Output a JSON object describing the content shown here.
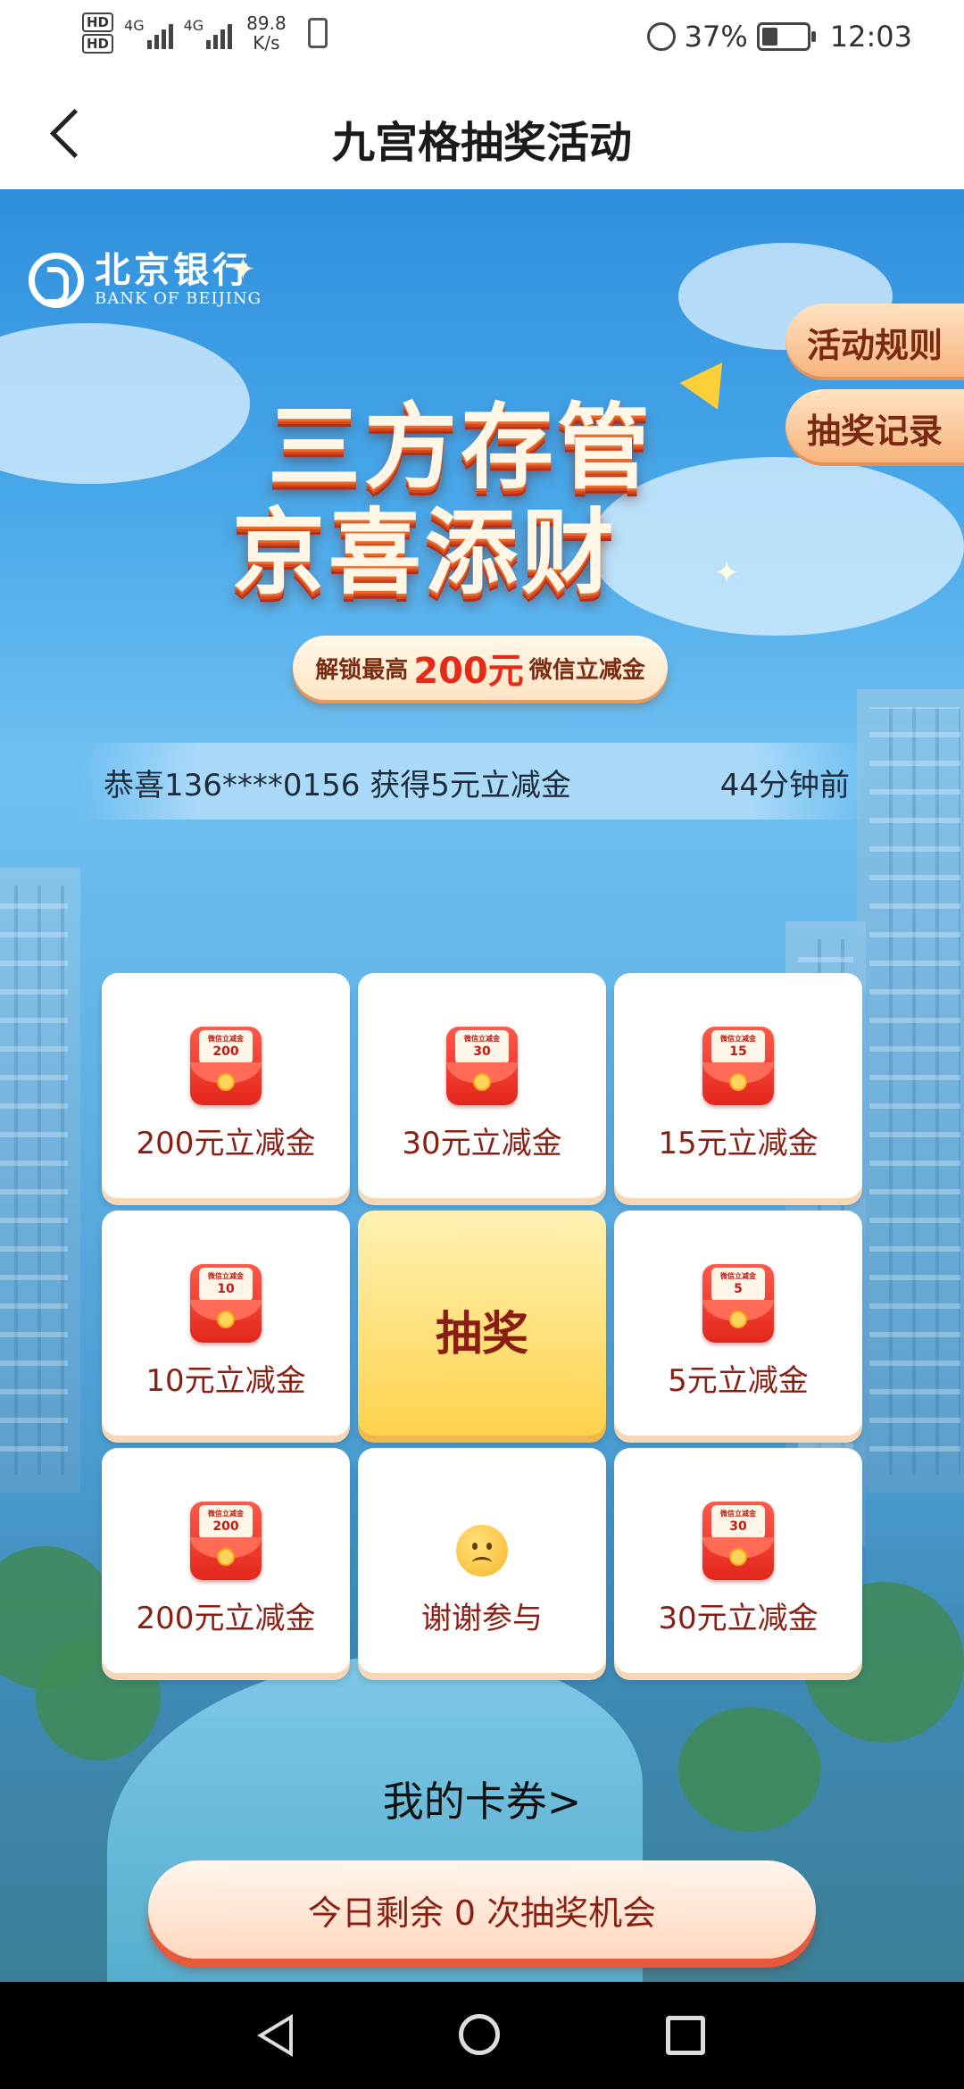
{
  "status_bar": {
    "hd1": "HD",
    "hd2": "HD",
    "net1": "4G",
    "net2": "4G",
    "speed_value": "89.8",
    "speed_unit": "K/s",
    "battery": "37%",
    "battery_level": 0.37,
    "time": "12:03"
  },
  "header": {
    "title": "九宫格抽奖活动"
  },
  "logo": {
    "cn": "北京银行",
    "en": "BANK OF BEIJING"
  },
  "side_buttons": {
    "rules": "活动规则",
    "records": "抽奖记录"
  },
  "banner": {
    "line1": "三方存管",
    "line2": "京喜添财",
    "sub_prefix": "解锁最高",
    "sub_amount": "200元",
    "sub_suffix": "微信立减金"
  },
  "ticker": {
    "message": "恭喜136****0156 获得5元立减金",
    "time": "44分钟前"
  },
  "grid": {
    "draw_label": "抽奖",
    "envelope_caption": "微信立减金",
    "prizes": [
      {
        "label": "200元立减金",
        "amount": "200"
      },
      {
        "label": "30元立减金",
        "amount": "30"
      },
      {
        "label": "15元立减金",
        "amount": "15"
      },
      {
        "label": "10元立减金",
        "amount": "10"
      },
      {
        "label": "5元立减金",
        "amount": "5"
      },
      {
        "label": "200元立减金",
        "amount": "200"
      },
      {
        "label": "谢谢参与",
        "amount": ""
      },
      {
        "label": "30元立减金",
        "amount": "30"
      }
    ]
  },
  "footer": {
    "my_coupons": "我的卡券>",
    "remaining": "今日剩余 0 次抽奖机会"
  },
  "icons": {
    "back": "chevron-left-icon",
    "nav_back": "triangle-back-icon",
    "nav_home": "circle-home-icon",
    "nav_recent": "square-recent-icon"
  }
}
